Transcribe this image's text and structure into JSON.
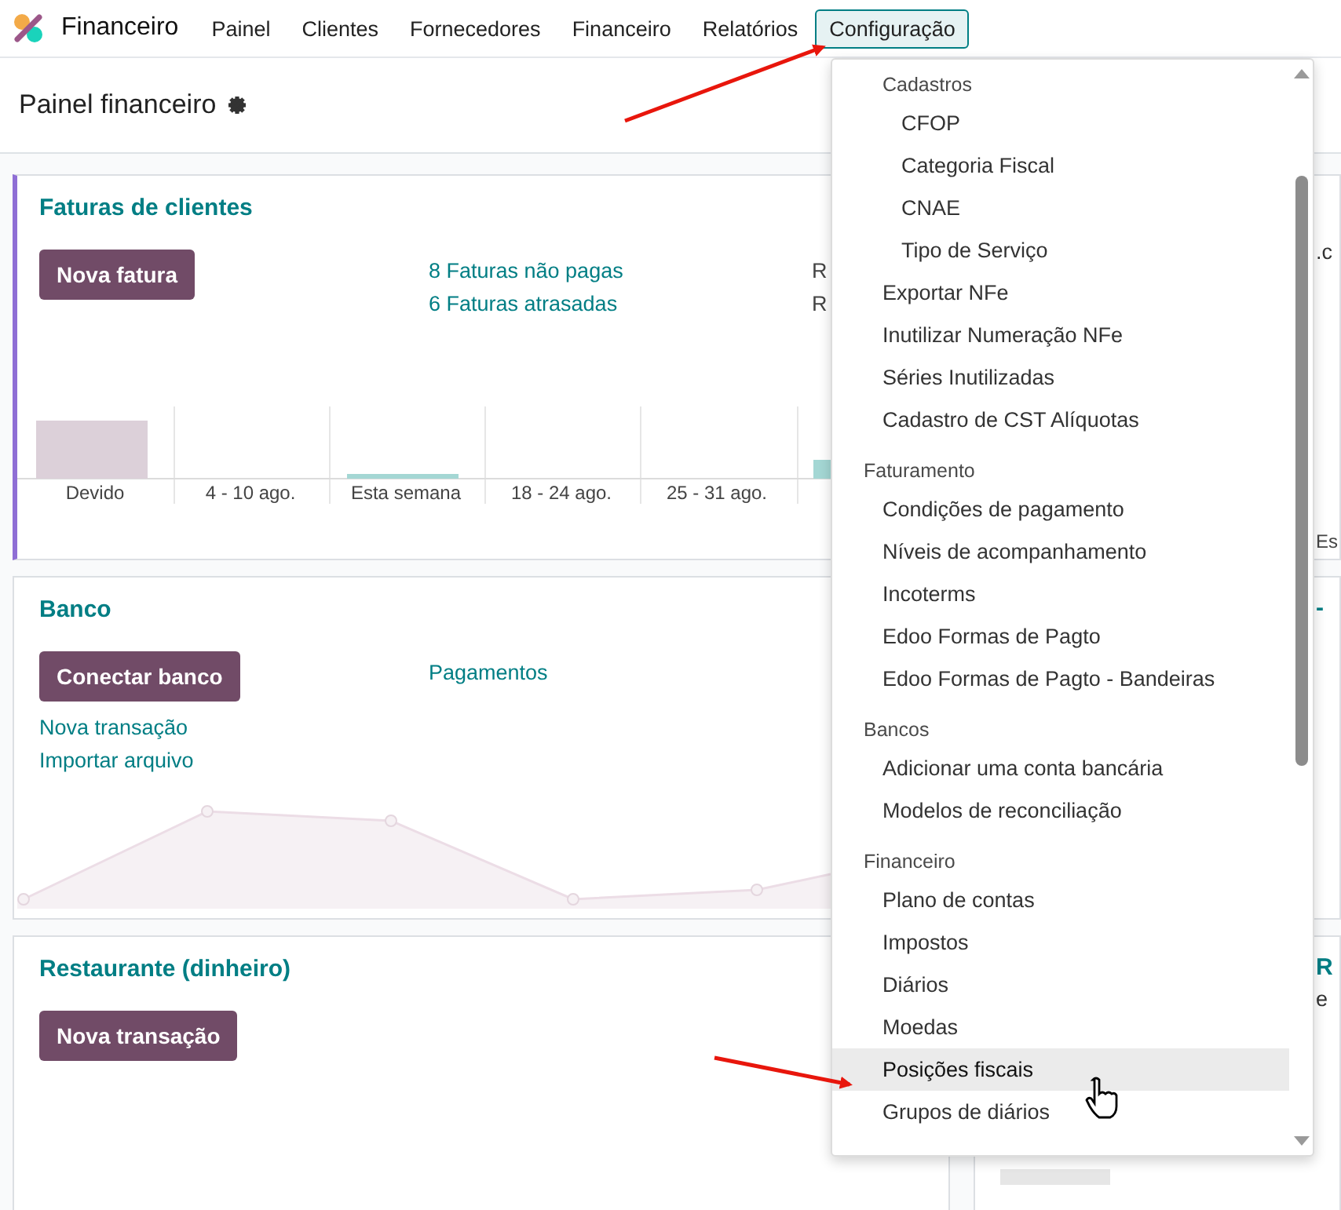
{
  "app": {
    "name": "Financeiro"
  },
  "nav": [
    {
      "label": "Painel",
      "selected": false
    },
    {
      "label": "Clientes",
      "selected": false
    },
    {
      "label": "Fornecedores",
      "selected": false
    },
    {
      "label": "Financeiro",
      "selected": false
    },
    {
      "label": "Relatórios",
      "selected": false
    },
    {
      "label": "Configuração",
      "selected": true
    }
  ],
  "page": {
    "title": "Painel financeiro"
  },
  "cards": [
    {
      "title": "Faturas de clientes",
      "accent": true,
      "button": "Nova fatura",
      "links": [
        "8 Faturas não pagas",
        "6 Faturas atrasadas"
      ],
      "amounts": [
        "R",
        "R"
      ],
      "chart": {
        "kind": "bar",
        "labels": [
          "Devido",
          "4 - 10 ago.",
          "Esta semana",
          "18 - 24 ago.",
          "25 - 31 ago."
        ]
      }
    },
    {
      "title": "Banco",
      "accent": false,
      "button": "Conectar banco",
      "side_links": [
        "Pagamentos"
      ],
      "links": [
        "Nova transação",
        "Importar arquivo"
      ],
      "chart": {
        "kind": "line"
      }
    },
    {
      "title": "Restaurante (dinheiro)",
      "accent": false,
      "button": "Nova transação"
    }
  ],
  "right_cards": [
    {
      "lines": [
        {
          "text": ".c",
          "kind": "body"
        },
        {
          "text": "Es",
          "kind": "axis"
        }
      ]
    },
    {
      "lines": [
        {
          "text": "-",
          "kind": "title"
        }
      ]
    },
    {
      "lines": [
        {
          "text": "R",
          "kind": "title"
        },
        {
          "text": "e",
          "kind": "body"
        }
      ]
    }
  ],
  "menu": {
    "sections": [
      {
        "items": [
          {
            "kind": "header",
            "label": "Cadastros",
            "children": [
              {
                "kind": "item",
                "label": "CFOP",
                "selected": false
              },
              {
                "kind": "item",
                "label": "Categoria Fiscal",
                "selected": false
              },
              {
                "kind": "item",
                "label": "CNAE",
                "selected": false
              },
              {
                "kind": "item",
                "label": "Tipo de Serviço",
                "selected": false
              }
            ]
          },
          {
            "kind": "item",
            "label": "Exportar NFe",
            "selected": false
          },
          {
            "kind": "item",
            "label": "Inutilizar Numeração NFe",
            "selected": false
          },
          {
            "kind": "item",
            "label": "Séries Inutilizadas",
            "selected": false
          },
          {
            "kind": "item",
            "label": "Cadastro de CST Alíquotas",
            "selected": false
          }
        ]
      },
      {
        "title": "Faturamento",
        "items": [
          {
            "kind": "item",
            "label": "Condições de pagamento",
            "selected": false
          },
          {
            "kind": "item",
            "label": "Níveis de acompanhamento",
            "selected": false
          },
          {
            "kind": "item",
            "label": "Incoterms",
            "selected": false
          },
          {
            "kind": "item",
            "label": "Edoo Formas de Pagto",
            "selected": false
          },
          {
            "kind": "item",
            "label": "Edoo Formas de Pagto - Bandeiras",
            "selected": false
          }
        ]
      },
      {
        "title": "Bancos",
        "items": [
          {
            "kind": "item",
            "label": "Adicionar uma conta bancária",
            "selected": false
          },
          {
            "kind": "item",
            "label": "Modelos de reconciliação",
            "selected": false
          }
        ]
      },
      {
        "title": "Financeiro",
        "items": [
          {
            "kind": "item",
            "label": "Plano de contas",
            "selected": false
          },
          {
            "kind": "item",
            "label": "Impostos",
            "selected": false
          },
          {
            "kind": "item",
            "label": "Diários",
            "selected": false
          },
          {
            "kind": "item",
            "label": "Moedas",
            "selected": false
          },
          {
            "kind": "item",
            "label": "Posições fiscais",
            "selected": true
          },
          {
            "kind": "item",
            "label": "Grupos de diários",
            "selected": false
          }
        ]
      }
    ]
  }
}
